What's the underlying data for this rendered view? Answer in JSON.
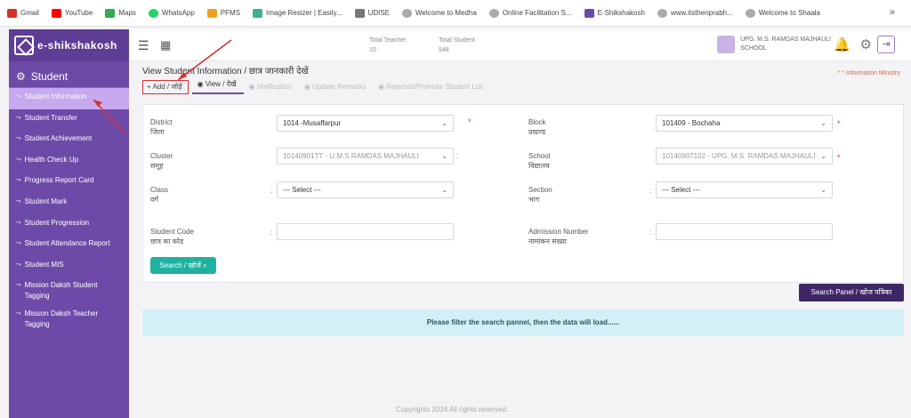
{
  "bookmarks": [
    {
      "label": "Gmail",
      "color": "#d93025"
    },
    {
      "label": "YouTube",
      "color": "#ff0000"
    },
    {
      "label": "Maps",
      "color": "#34a853"
    },
    {
      "label": "WhatsApp",
      "color": "#25d366"
    },
    {
      "label": "PFMS",
      "color": "#f0a020"
    },
    {
      "label": "Image Resizer | Easily...",
      "color": "#3fb08f"
    },
    {
      "label": "UDISE",
      "color": "#777777"
    },
    {
      "label": "Welcome to Medha",
      "color": "#888888"
    },
    {
      "label": "Online Facilitation S...",
      "color": "#888888"
    },
    {
      "label": "E-Shikshakosh",
      "color": "#6e4aa8"
    },
    {
      "label": "www.itsthenprabh...",
      "color": "#888888"
    },
    {
      "label": "Welcome to Shaala",
      "color": "#888888"
    }
  ],
  "sidebar": {
    "brand": "e-shikshakosh",
    "section": "Student",
    "items": [
      "Student Information",
      "Student Transfer",
      "Student Achievement",
      "Health Check Up",
      "Progress Report Card",
      "Student Mark",
      "Student Progression",
      "Student Attendance Report",
      "Student MIS",
      "Mission Daksh Student Tagging",
      "Mission Daksh Teacher Tagging"
    ]
  },
  "topbar": {
    "total_teacher_label": "Total Teacher",
    "total_teacher_value": "10",
    "total_student_label": "Total Student",
    "total_student_value": "548",
    "user_name": "UPG. M.S. RAMDAS MAJHAULI",
    "user_role": "SCHOOL"
  },
  "page": {
    "title": "View Student Information / छात्र जानकारी देखें",
    "marquee": "* * Information Ministry",
    "tabs": [
      "+ Add / जोड़ें",
      "View / देखें",
      "Verification",
      "Update Remarks",
      "Rejected/Promote Student List"
    ]
  },
  "form": {
    "district_label": "District",
    "district_label_hi": "जिला",
    "district_value": "1014 -Musaffarpur",
    "block_label": "Block",
    "block_label_hi": "प्रखण्ड",
    "block_value": "101409 - Bochaha",
    "cluster_label": "Cluster",
    "cluster_label_hi": "समूह",
    "cluster_value": "10140901TT - U.M.S RAMDAS MAJHAULI",
    "school_label": "School",
    "school_label_hi": "विद्यालय",
    "school_value": "10140907102 - UPG. M.S. RAMDAS MAJHAULI",
    "class_label": "Class",
    "class_label_hi": "वर्ग",
    "class_value": "--- Select ---",
    "section_label": "Section",
    "section_label_hi": "भाग",
    "section_value": "--- Select ---",
    "student_code_label": "Student Code",
    "student_code_label_hi": "छात्र का कोड",
    "admission_label": "Admission Number",
    "admission_label_hi": "नामांकन संख्या",
    "colon": ":",
    "required": "*",
    "search_button": "Search / खोजें"
  },
  "search_panel_button": "Search Panel / खोज पत्रिका",
  "info_message": "Please filter the search pannel, then the data will load......",
  "footer": "Copyrights 2024 All rights reserved.",
  "colors": {
    "sidebar": "#6e4aa8",
    "accent_teal": "#20b2a0",
    "dark_button": "#3f2767",
    "annotation_red": "#d93030"
  }
}
